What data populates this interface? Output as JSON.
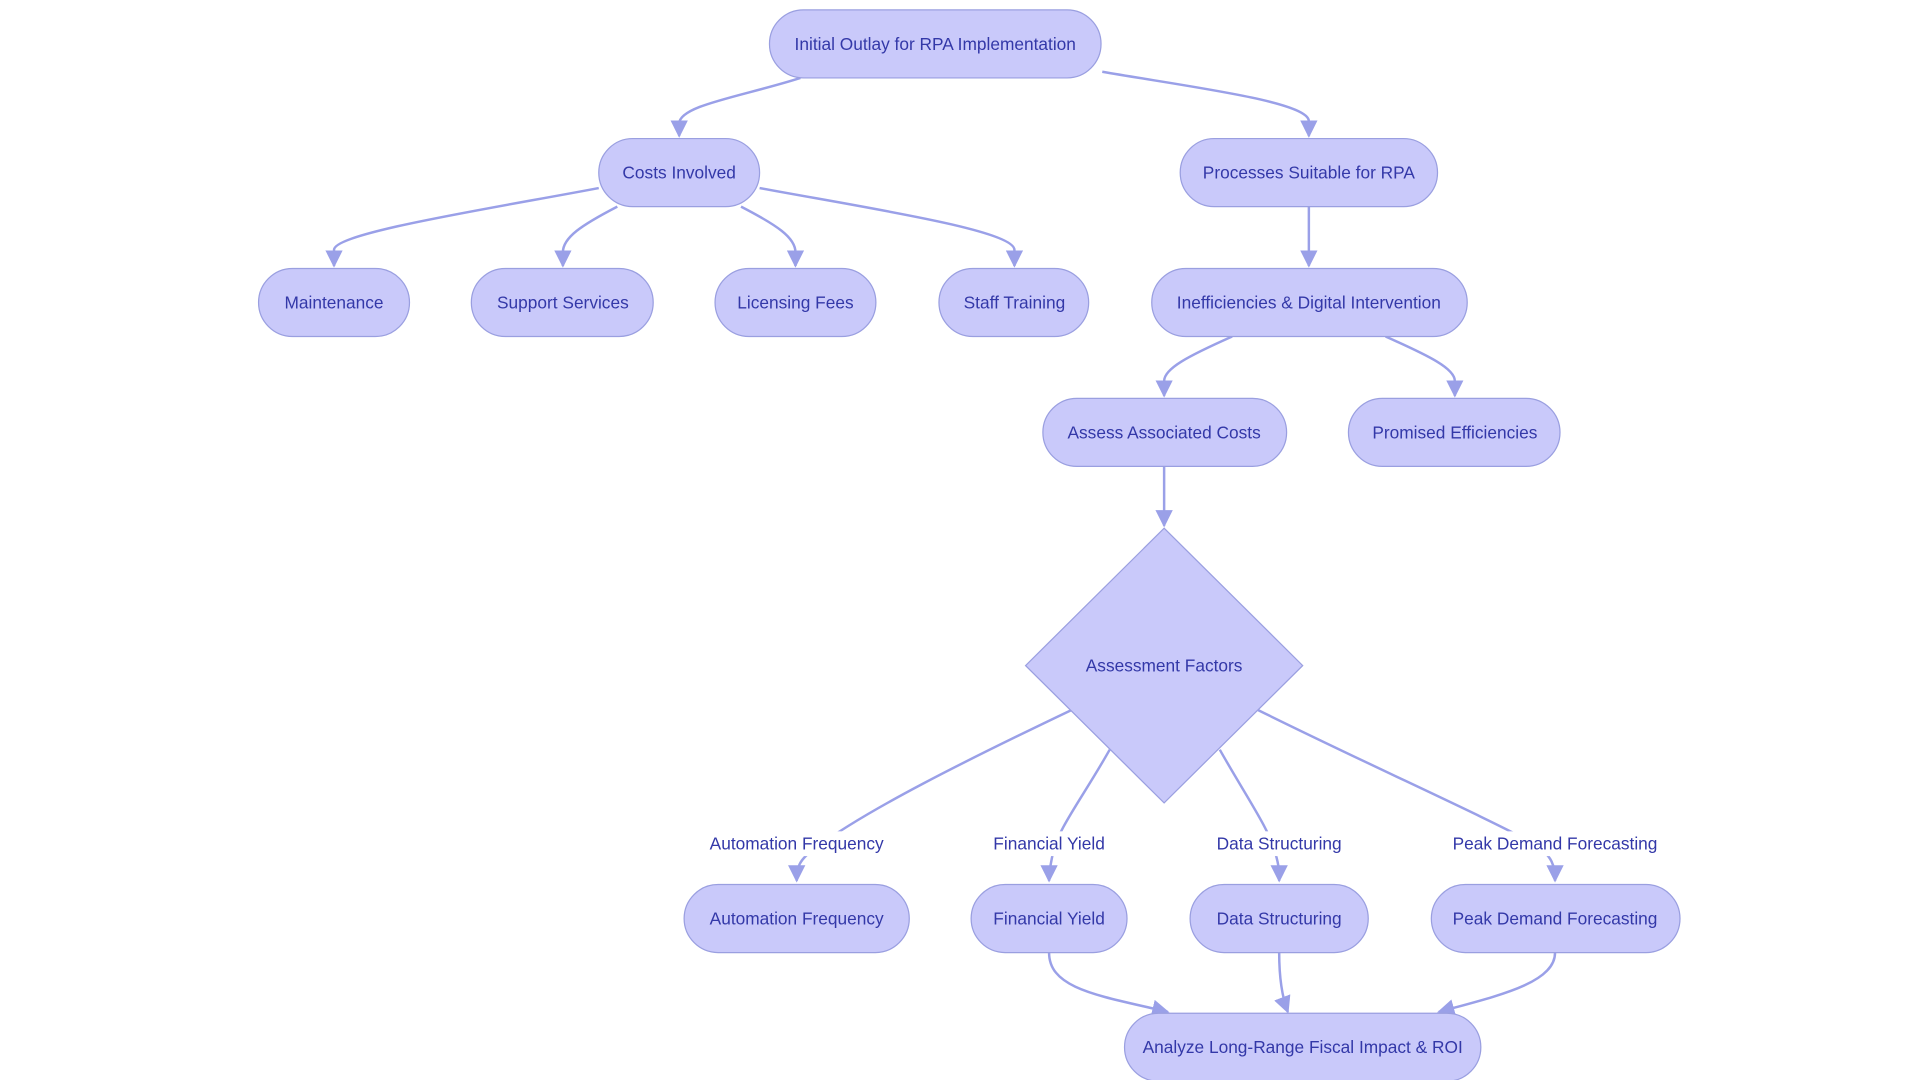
{
  "diagram": {
    "type": "flowchart",
    "colors": {
      "node_fill": "#C9C9FA",
      "node_stroke": "#9A9FE0",
      "text": "#3338A8",
      "edge": "#9AA0E8"
    },
    "nodes": {
      "initial_outlay": "Initial Outlay for RPA Implementation",
      "costs_involved": "Costs Involved",
      "processes_suitable": "Processes Suitable for RPA",
      "maintenance": "Maintenance",
      "support_services": "Support Services",
      "licensing_fees": "Licensing Fees",
      "staff_training": "Staff Training",
      "inefficiencies": "Inefficiencies & Digital Intervention",
      "assess_costs": "Assess Associated Costs",
      "promised_efficiencies": "Promised Efficiencies",
      "assessment_factors": "Assessment Factors",
      "automation_frequency": "Automation Frequency",
      "financial_yield": "Financial Yield",
      "data_structuring": "Data Structuring",
      "peak_demand": "Peak Demand Forecasting",
      "analyze_roi": "Analyze Long-Range Fiscal Impact & ROI"
    },
    "edge_labels": {
      "automation_frequency": "Automation Frequency",
      "financial_yield": "Financial Yield",
      "data_structuring": "Data Structuring",
      "peak_demand": "Peak Demand Forecasting"
    },
    "edges": [
      {
        "from": "initial_outlay",
        "to": "costs_involved"
      },
      {
        "from": "initial_outlay",
        "to": "processes_suitable"
      },
      {
        "from": "costs_involved",
        "to": "maintenance"
      },
      {
        "from": "costs_involved",
        "to": "support_services"
      },
      {
        "from": "costs_involved",
        "to": "licensing_fees"
      },
      {
        "from": "costs_involved",
        "to": "staff_training"
      },
      {
        "from": "processes_suitable",
        "to": "inefficiencies"
      },
      {
        "from": "inefficiencies",
        "to": "assess_costs"
      },
      {
        "from": "inefficiencies",
        "to": "promised_efficiencies"
      },
      {
        "from": "assess_costs",
        "to": "assessment_factors"
      },
      {
        "from": "assessment_factors",
        "to": "automation_frequency",
        "label": "Automation Frequency"
      },
      {
        "from": "assessment_factors",
        "to": "financial_yield",
        "label": "Financial Yield"
      },
      {
        "from": "assessment_factors",
        "to": "data_structuring",
        "label": "Data Structuring"
      },
      {
        "from": "assessment_factors",
        "to": "peak_demand",
        "label": "Peak Demand Forecasting"
      },
      {
        "from": "financial_yield",
        "to": "analyze_roi"
      },
      {
        "from": "data_structuring",
        "to": "analyze_roi"
      },
      {
        "from": "peak_demand",
        "to": "analyze_roi"
      }
    ]
  }
}
